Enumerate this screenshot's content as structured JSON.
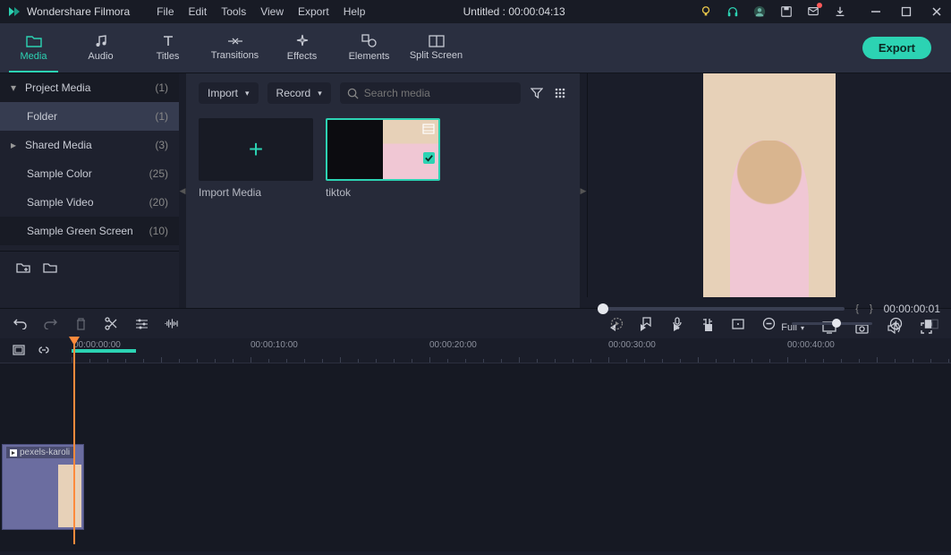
{
  "app": {
    "name": "Wondershare Filmora"
  },
  "menubar": {
    "file": "File",
    "edit": "Edit",
    "tools": "Tools",
    "view": "View",
    "export": "Export",
    "help": "Help"
  },
  "title": "Untitled : 00:00:04:13",
  "toolbar": {
    "media": "Media",
    "audio": "Audio",
    "titles": "Titles",
    "transitions": "Transitions",
    "effects": "Effects",
    "elements": "Elements",
    "splitscreen": "Split Screen",
    "export_btn": "Export"
  },
  "sidebar": {
    "items": [
      {
        "label": "Project Media",
        "count": "(1)"
      },
      {
        "label": "Folder",
        "count": "(1)"
      },
      {
        "label": "Shared Media",
        "count": "(3)"
      },
      {
        "label": "Sample Color",
        "count": "(25)"
      },
      {
        "label": "Sample Video",
        "count": "(20)"
      },
      {
        "label": "Sample Green Screen",
        "count": "(10)"
      }
    ]
  },
  "media": {
    "import_btn": "Import",
    "record_btn": "Record",
    "search_placeholder": "Search media",
    "import_card": "Import Media",
    "clip1": "tiktok"
  },
  "preview": {
    "timecode": "00:00:00:01",
    "bracket_l": "{",
    "bracket_r": "}",
    "full": "Full"
  },
  "timeline": {
    "times": [
      "00:00:00:00",
      "00:00:10:00",
      "00:00:20:00",
      "00:00:30:00",
      "00:00:40:00"
    ],
    "clip_name": "pexels-karoli",
    "track_id": "1"
  },
  "colors": {
    "accent": "#2cd3b3",
    "playhead": "#ff8a3c"
  }
}
